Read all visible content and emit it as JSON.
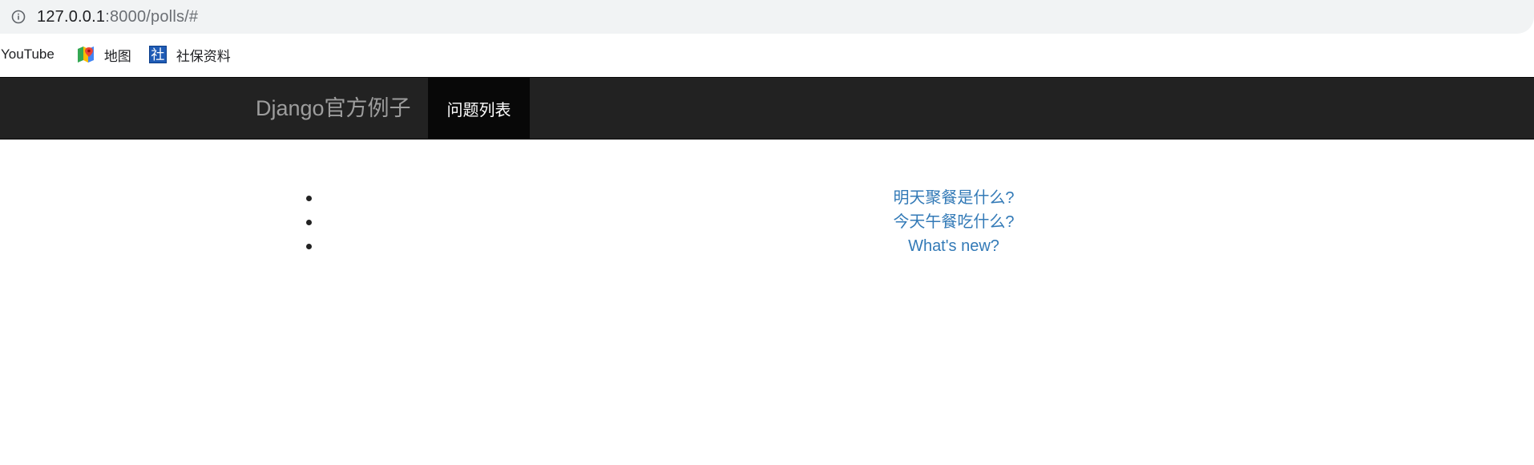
{
  "browser": {
    "url_host": "127.0.0.1",
    "url_rest": ":8000/polls/#",
    "info_icon": "info-icon"
  },
  "bookmarks": [
    {
      "label": "YouTube",
      "icon": null
    },
    {
      "label": "地图",
      "icon": "maps-icon"
    },
    {
      "label": "社保资料",
      "icon": "she-icon",
      "icon_text": "社"
    }
  ],
  "navbar": {
    "brand": "Django官方例子",
    "active_item": "问题列表"
  },
  "questions": [
    {
      "text": "明天聚餐是什么?"
    },
    {
      "text": "今天午餐吃什么?"
    },
    {
      "text": "What's new?"
    }
  ],
  "colors": {
    "navbar_bg": "#222222",
    "active_bg": "#080808",
    "link": "#337ab7",
    "brand_text": "#9d9d9d"
  }
}
